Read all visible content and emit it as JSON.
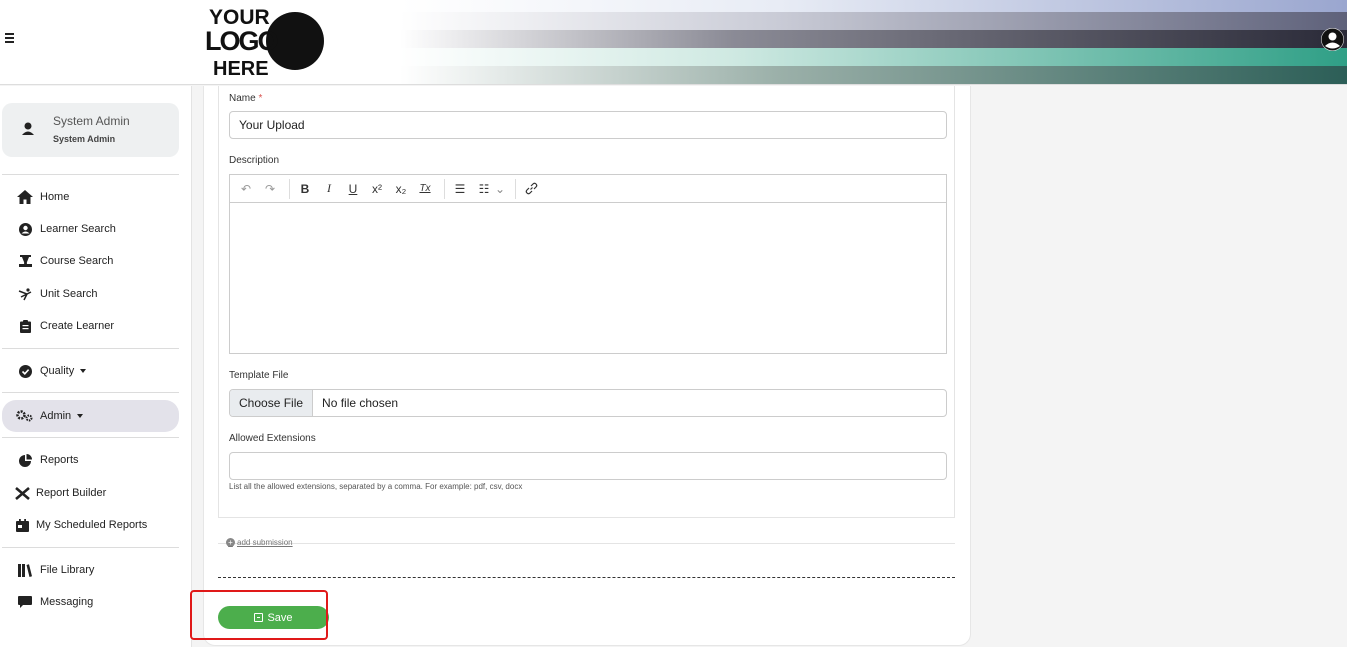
{
  "header": {
    "logo_lines": [
      "YOUR",
      "LOGO",
      "HERE"
    ],
    "menu_icon": "hamburger-icon",
    "user_icon": "user-circle-icon"
  },
  "sidebar": {
    "profile": {
      "name": "System Admin",
      "role": "System Admin",
      "icon": "user-icon"
    },
    "items": [
      {
        "label": "Home",
        "icon": "home-icon"
      },
      {
        "label": "Learner Search",
        "icon": "user-circle-icon"
      },
      {
        "label": "Course Search",
        "icon": "course-icon"
      },
      {
        "label": "Unit Search",
        "icon": "unit-icon"
      },
      {
        "label": "Create Learner",
        "icon": "clipboard-icon"
      },
      {
        "label": "Quality",
        "icon": "check-circle-icon"
      },
      {
        "label": "Admin",
        "icon": "cogs-icon"
      },
      {
        "label": "Reports",
        "icon": "pie-chart-icon"
      },
      {
        "label": "Report Builder",
        "icon": "tools-icon"
      },
      {
        "label": "My Scheduled Reports",
        "icon": "calendar-icon"
      },
      {
        "label": "File Library",
        "icon": "library-icon"
      },
      {
        "label": "Messaging",
        "icon": "comment-icon"
      }
    ]
  },
  "form": {
    "name_label": "Name",
    "required_mark": "*",
    "name_value": "Your Upload",
    "description_label": "Description",
    "toolbar": {
      "undo": "↶",
      "redo": "↷",
      "bold": "B",
      "italic": "I",
      "underline": "U",
      "superscript": "x²",
      "subscript": "x₂",
      "clear": "Tx",
      "bullets": "☰",
      "numbered": "☷",
      "dropdown": "⌄",
      "link": "🔗"
    },
    "template_file_label": "Template File",
    "choose_file": "Choose File",
    "no_file": "No file chosen",
    "allowed_ext_label": "Allowed Extensions",
    "allowed_ext_value": "",
    "allowed_ext_hint": "List all the allowed extensions, separated by a comma. For example: pdf, csv, docx",
    "add_submission": "add submission",
    "save_label": "Save"
  },
  "colors": {
    "save_green": "#4cae4c",
    "highlight_red": "#e01919",
    "active_nav": "#e3e2ea"
  }
}
